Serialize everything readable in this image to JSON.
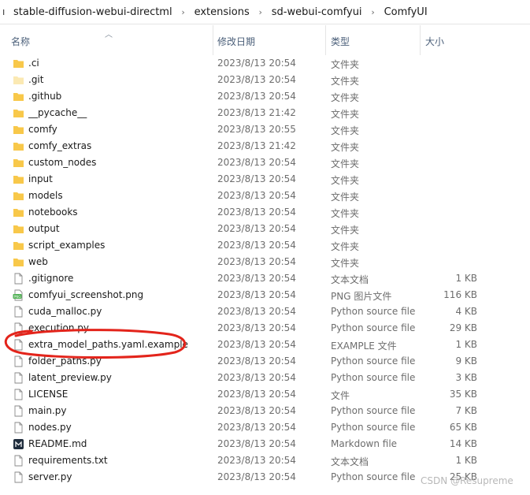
{
  "breadcrumb": {
    "lead": "ı",
    "items": [
      "stable-diffusion-webui-directml",
      "extensions",
      "sd-webui-comfyui",
      "ComfyUI"
    ],
    "separator": "›"
  },
  "columns": {
    "name": "名称",
    "date": "修改日期",
    "type": "类型",
    "size": "大小"
  },
  "files": [
    {
      "name": ".ci",
      "date": "2023/8/13 20:54",
      "type": "文件夹",
      "size": "",
      "icon": "folder-icon"
    },
    {
      "name": ".git",
      "date": "2023/8/13 20:54",
      "type": "文件夹",
      "size": "",
      "icon": "folder-hidden-icon"
    },
    {
      "name": ".github",
      "date": "2023/8/13 20:54",
      "type": "文件夹",
      "size": "",
      "icon": "folder-icon"
    },
    {
      "name": "__pycache__",
      "date": "2023/8/13 21:42",
      "type": "文件夹",
      "size": "",
      "icon": "folder-icon"
    },
    {
      "name": "comfy",
      "date": "2023/8/13 20:55",
      "type": "文件夹",
      "size": "",
      "icon": "folder-icon"
    },
    {
      "name": "comfy_extras",
      "date": "2023/8/13 21:42",
      "type": "文件夹",
      "size": "",
      "icon": "folder-icon"
    },
    {
      "name": "custom_nodes",
      "date": "2023/8/13 20:54",
      "type": "文件夹",
      "size": "",
      "icon": "folder-icon"
    },
    {
      "name": "input",
      "date": "2023/8/13 20:54",
      "type": "文件夹",
      "size": "",
      "icon": "folder-icon"
    },
    {
      "name": "models",
      "date": "2023/8/13 20:54",
      "type": "文件夹",
      "size": "",
      "icon": "folder-icon"
    },
    {
      "name": "notebooks",
      "date": "2023/8/13 20:54",
      "type": "文件夹",
      "size": "",
      "icon": "folder-icon"
    },
    {
      "name": "output",
      "date": "2023/8/13 20:54",
      "type": "文件夹",
      "size": "",
      "icon": "folder-icon"
    },
    {
      "name": "script_examples",
      "date": "2023/8/13 20:54",
      "type": "文件夹",
      "size": "",
      "icon": "folder-icon"
    },
    {
      "name": "web",
      "date": "2023/8/13 20:54",
      "type": "文件夹",
      "size": "",
      "icon": "folder-icon"
    },
    {
      "name": ".gitignore",
      "date": "2023/8/13 20:54",
      "type": "文本文档",
      "size": "1 KB",
      "icon": "file-icon"
    },
    {
      "name": "comfyui_screenshot.png",
      "date": "2023/8/13 20:54",
      "type": "PNG 图片文件",
      "size": "116 KB",
      "icon": "png-file-icon"
    },
    {
      "name": "cuda_malloc.py",
      "date": "2023/8/13 20:54",
      "type": "Python source file",
      "size": "4 KB",
      "icon": "file-icon"
    },
    {
      "name": "execution.py",
      "date": "2023/8/13 20:54",
      "type": "Python source file",
      "size": "29 KB",
      "icon": "file-icon"
    },
    {
      "name": "extra_model_paths.yaml.example",
      "date": "2023/8/13 20:54",
      "type": "EXAMPLE 文件",
      "size": "1 KB",
      "icon": "file-icon"
    },
    {
      "name": "folder_paths.py",
      "date": "2023/8/13 20:54",
      "type": "Python source file",
      "size": "9 KB",
      "icon": "file-icon"
    },
    {
      "name": "latent_preview.py",
      "date": "2023/8/13 20:54",
      "type": "Python source file",
      "size": "3 KB",
      "icon": "file-icon"
    },
    {
      "name": "LICENSE",
      "date": "2023/8/13 20:54",
      "type": "文件",
      "size": "35 KB",
      "icon": "file-icon"
    },
    {
      "name": "main.py",
      "date": "2023/8/13 20:54",
      "type": "Python source file",
      "size": "7 KB",
      "icon": "file-icon"
    },
    {
      "name": "nodes.py",
      "date": "2023/8/13 20:54",
      "type": "Python source file",
      "size": "65 KB",
      "icon": "file-icon"
    },
    {
      "name": "README.md",
      "date": "2023/8/13 20:54",
      "type": "Markdown file",
      "size": "14 KB",
      "icon": "markdown-file-icon"
    },
    {
      "name": "requirements.txt",
      "date": "2023/8/13 20:54",
      "type": "文本文档",
      "size": "1 KB",
      "icon": "file-icon"
    },
    {
      "name": "server.py",
      "date": "2023/8/13 20:54",
      "type": "Python source file",
      "size": "25 KB",
      "icon": "file-icon"
    }
  ],
  "watermark": "CSDN @Resupreme",
  "colors": {
    "folder": "#f8c84a",
    "folder_hidden": "#fbe9b3",
    "annotation": "#e3241b",
    "png_badge": "#4caf50",
    "markdown_badge": "#1f2d3d"
  }
}
